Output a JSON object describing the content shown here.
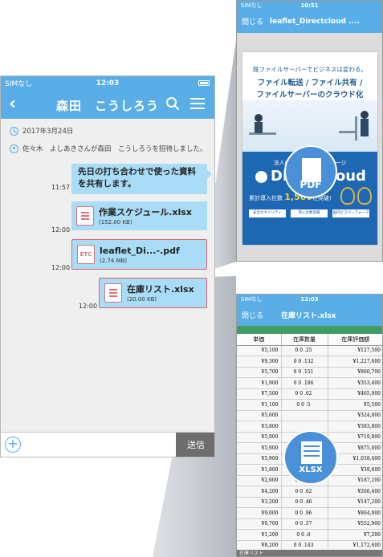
{
  "chat": {
    "status": {
      "carrier": "SIMなし",
      "time": "12:03"
    },
    "title": "森田　こうしろう",
    "date_line": "2017年3月24日",
    "invite_line": "佐々木　よしあきさんが森田　こうしろうを招待しました。",
    "messages": [
      {
        "time": "11:57",
        "text": "先日の打ち合わせで使った資料を共有します。"
      },
      {
        "time": "12:00",
        "file": "作業スケジュール.xlsx",
        "size": "(152.00 KB)",
        "icon": "list-file-icon"
      },
      {
        "time": "12:00",
        "file": "leaflet_Di...-.pdf",
        "size": "(2.74 MB)",
        "icon": "etc-file-icon",
        "icon_label": "ETC"
      },
      {
        "time": "12:00",
        "file": "在庫リスト.xlsx",
        "size": "(20.00 KB)",
        "icon": "list-file-icon"
      }
    ],
    "send_label": "送信",
    "accent": "#5aaee8"
  },
  "pdf_viewer": {
    "status": {
      "carrier": "SIMなし",
      "time": "10:51"
    },
    "close_label": "閉じる",
    "title": "leaflet_Directcloud ....",
    "doc": {
      "line1": "既ファイルサーバーでビジネスは変わる。",
      "line2": "ファイル転送 / ファイル共有 /",
      "line3": "ファイルサーバーのクラウド化",
      "subtitle": "法人向けクラウドストレージ",
      "brand": "DirectCloud",
      "users_prefix": "累計導入社数",
      "users_count": "1,500",
      "users_suffix": "社突破!",
      "features": [
        "安全セキュリティ",
        "導入社数実績",
        "国内ビスパーフォーマンス"
      ]
    },
    "badge_label": "PDF"
  },
  "xlsx_viewer": {
    "status": {
      "carrier": "SIMなし",
      "time": "12:03"
    },
    "close_label": "閉じる",
    "title": "在庫リスト.xlsx",
    "columns": [
      "単価",
      "在庫数量",
      "在庫評価額"
    ],
    "rows": [
      [
        "¥5,100",
        "0 0 .25",
        "¥127,500"
      ],
      [
        "¥9,300",
        "0 0 .132",
        "¥1,227,600"
      ],
      [
        "¥5,700",
        "0 0 .151",
        "¥860,700"
      ],
      [
        "¥1,900",
        "0 0 .186",
        "¥353,400"
      ],
      [
        "¥7,500",
        "0 0 .62",
        "¥465,000"
      ],
      [
        "¥1,100",
        "0 0 .5",
        "¥5,500"
      ],
      [
        "¥5,600",
        "",
        "¥324,800"
      ],
      [
        "¥3,800",
        "",
        "¥383,800"
      ],
      [
        "¥5,900",
        "",
        "¥719,800"
      ],
      [
        "¥5,900",
        "",
        "¥875,000"
      ],
      [
        "¥5,900",
        "",
        "¥1,038,400"
      ],
      [
        "¥1,800",
        "0 0 .22",
        "¥39,600"
      ],
      [
        "¥2,600",
        "0 0 .72",
        "¥187,200"
      ],
      [
        "¥4,200",
        "0 0 .62",
        "¥260,400"
      ],
      [
        "¥3,200",
        "0 0 .46",
        "¥147,200"
      ],
      [
        "¥9,000",
        "0 0 .96",
        "¥864,000"
      ],
      [
        "¥9,700",
        "0 0 .57",
        "¥552,900"
      ],
      [
        "¥1,200",
        "0 0 .6",
        "¥7,200"
      ],
      [
        "¥8,200",
        "0 0 .143",
        "¥1,172,600"
      ],
      [
        "¥1,600",
        "0 0 .124",
        "¥198,400"
      ]
    ],
    "sheet_tab": "在庫リスト",
    "badge_label": "XLSX",
    "header_green": "#3f9e64"
  }
}
